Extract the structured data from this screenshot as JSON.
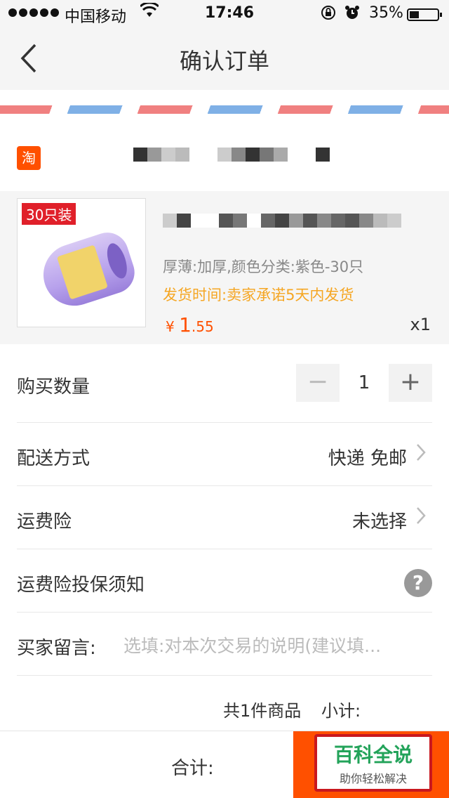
{
  "status_bar": {
    "carrier": "中国移动",
    "time": "17:46",
    "battery": "35%",
    "battery_level": 0.35,
    "icons": [
      "signal-dots-icon",
      "wifi-icon",
      "rotation-lock-icon",
      "alarm-icon",
      "battery-icon"
    ]
  },
  "nav": {
    "title": "确认订单",
    "back_icon": "chevron-left-icon"
  },
  "shop": {
    "icon_text": "淘",
    "icon_color": "#ff5000"
  },
  "item": {
    "thumb_badge": "30只装",
    "sku": "厚薄:加厚,颜色分类:紫色-30只",
    "shipping": "发货时间:卖家承诺5天内发货",
    "price_symbol": "¥",
    "price_int": "1",
    "price_dec": ".55",
    "quantity_label": "x1"
  },
  "quantity_row": {
    "label": "购买数量",
    "value": "1",
    "minus": "−",
    "plus": "+"
  },
  "delivery_row": {
    "label": "配送方式",
    "value": "快递 免邮"
  },
  "insurance_row": {
    "label": "运费险",
    "value": "未选择"
  },
  "insurance_notice_row": {
    "label": "运费险投保须知",
    "help": "?"
  },
  "message_row": {
    "label": "买家留言:",
    "placeholder": "选填:对本次交易的说明(建议填..."
  },
  "subtotal": {
    "count": "共1件商品",
    "label": "小计:"
  },
  "footer": {
    "total_label": "合计:",
    "watermark_title": "百科全说",
    "watermark_sub": "助你轻松解决"
  },
  "colors": {
    "accent": "#ff5000",
    "shipping_text": "#f5a623",
    "watermark_green": "#23a35a",
    "watermark_border": "#c9181f"
  }
}
